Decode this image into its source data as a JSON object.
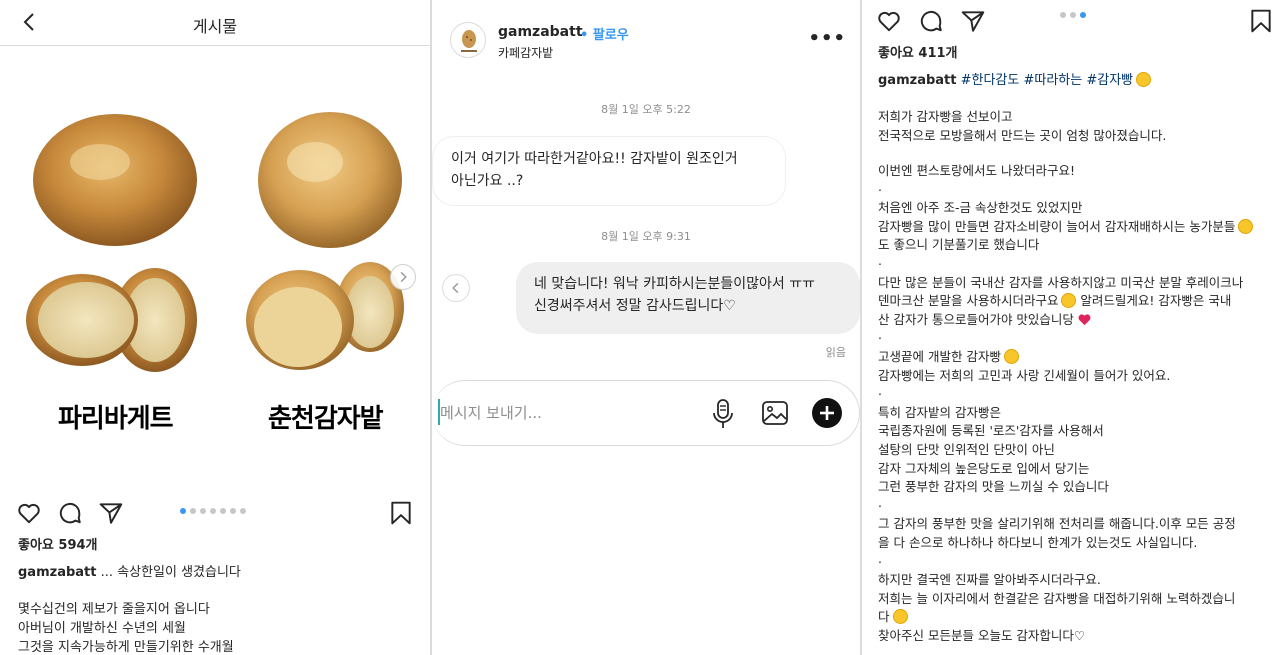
{
  "panel1": {
    "header_title": "게시물",
    "image_labels": [
      "파리바게트",
      "춘천감자밭"
    ],
    "carousel_dots": 7,
    "carousel_active": 1,
    "likes": "좋아요 594개",
    "caption_user": "gamzabatt",
    "caption_text": " ... 속상한일이 생겼습니다",
    "body_lines": [
      "몇수십건의 제보가 줄을지어 옵니다",
      "아버님이 개발하신 수년의 세월",
      "그것을 지속가능하게 만들기위한 수개월"
    ]
  },
  "panel2": {
    "username": "gamzabatt",
    "follow_label": "• 팔로우",
    "subtitle": "카페감자밭",
    "more_label": "•••",
    "time1": "8월 1일 오후 5:22",
    "msg_in": [
      "이거 여기가 따라한거같아요!! 감자밭이 원조인거",
      "아닌가요 ..?"
    ],
    "time2": "8월 1일 오후 9:31",
    "msg_out": [
      "네 맞습니다! 워낙 카피하시는분들이많아서 ㅠㅠ",
      "신경써주셔서 정말 감사드립니다♡"
    ],
    "read_label": "읽음",
    "input_placeholder": "메시지 보내기..."
  },
  "panel3": {
    "likes": "좋아요 411개",
    "carousel_dots": 3,
    "carousel_active": 3,
    "caption_user": "gamzabatt",
    "caption_tags": " #한다감도 #따라하는 #감자빵",
    "lines": [
      "저희가 감자빵을 선보이고",
      "전국적으로 모방을해서 만드는 곳이 엄청 많아졌습니다.",
      "",
      "이번엔 편스토랑에서도 나왔더라구요!",
      ".",
      "처음엔 아주 조-금 속상한것도 있었지만",
      "감자빵을 많이 만들면 감자소비량이 늘어서 감자재배하시는 농가분들",
      "도 좋으니 기분풀기로 했습니다",
      ".",
      "다만 많은 분들이 국내산 감자를 사용하지않고 미국산 분말 후레이크나",
      "덴마크산 분말을 사용하시더라구요",
      "산 감자가 통으로들어가야 맛있습니당",
      ".",
      "고생끝에 개발한 감자빵",
      "감자빵에는 저희의 고민과 사랑 긴세월이 들어가 있어요.",
      ".",
      "특히 감자밭의 감자빵은",
      "국립종자원에 등록된 '로즈'감자를 사용해서",
      "설탕의 단맛 인위적인 단맛이 아닌",
      "감자 그자체의 높은당도로 입에서 당기는",
      "그런 풍부한 감자의 맛을 느끼실 수 있습니다",
      ".",
      "그 감자의 풍부한 맛을 살리기위해 전처리를 해줍니다.이후 모든 공정",
      "을 다 손으로 하나하나 하다보니 한계가 있는것도 사실입니다.",
      ".",
      "하지만 결국엔 진짜를 알아봐주시더라구요.",
      "저희는 늘 이자리에서 한결같은 감자빵을 대접하기위해 노력하겠습니",
      "다",
      "찾아주신 모든분들 오늘도 감자합니다♡"
    ],
    "line11_tail": " 알려드릴게요! 감자빵은 국내"
  }
}
